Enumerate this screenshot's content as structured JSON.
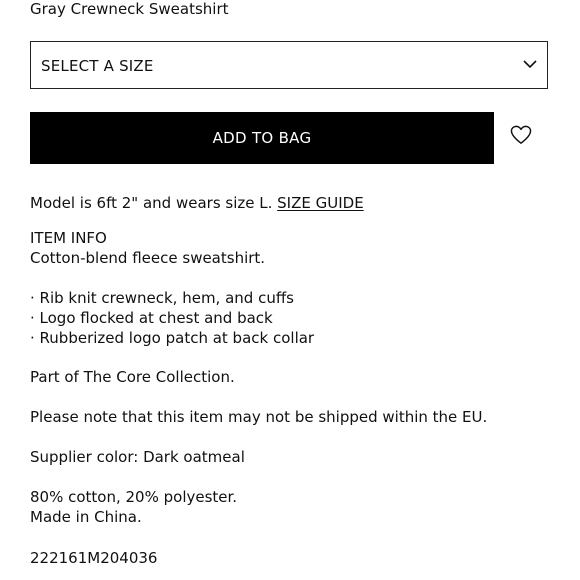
{
  "product": {
    "name": "Gray Crewneck Sweatshirt",
    "size_select_label": "SELECT A SIZE",
    "add_to_bag_label": "ADD TO BAG"
  },
  "fit": {
    "model_text": "Model is 6ft 2\" and wears size L. ",
    "size_guide_label": "SIZE GUIDE"
  },
  "info": {
    "heading": "ITEM INFO",
    "description": "Cotton-blend fleece sweatshirt.",
    "bullets": [
      "· Rib knit crewneck, hem, and cuffs",
      "· Logo flocked at chest and back",
      "· Rubberized logo patch at back collar"
    ],
    "collection": "Part of The Core Collection.",
    "shipping_note": "Please note that this item may not be shipped within the EU.",
    "supplier_color": "Supplier color: Dark oatmeal",
    "composition": "80% cotton, 20% polyester.",
    "origin": "Made in China.",
    "sku": "222161M204036"
  },
  "icons": {
    "dropdown": "chevron-down-icon",
    "wishlist": "heart-outline-icon"
  }
}
